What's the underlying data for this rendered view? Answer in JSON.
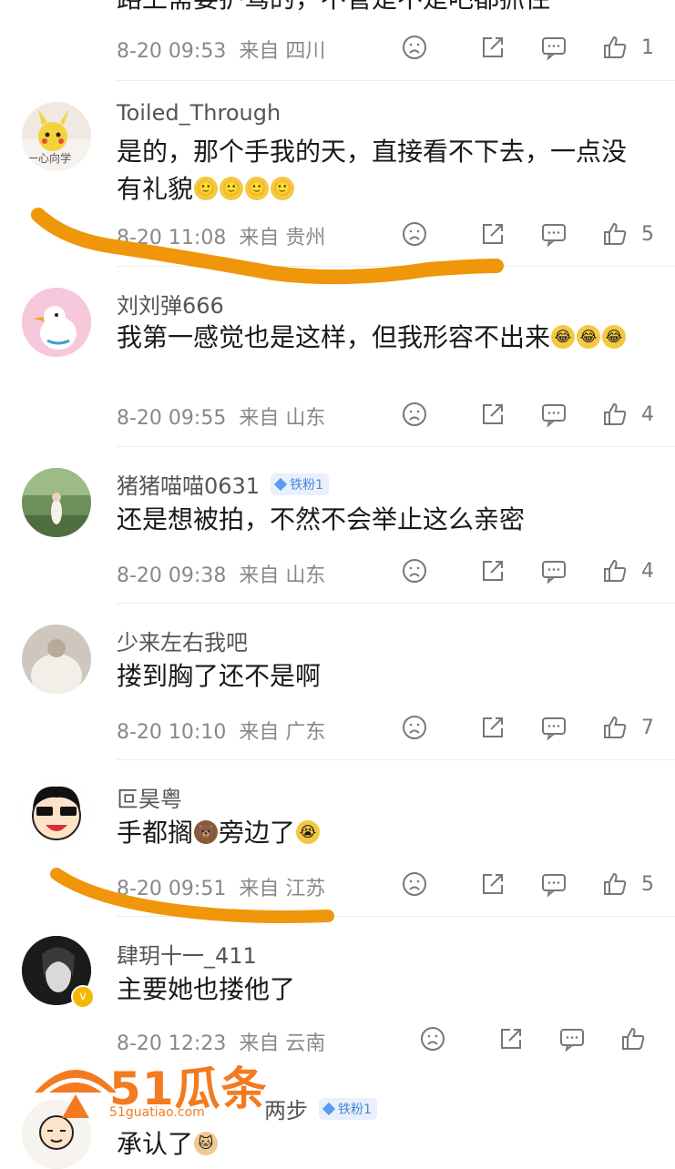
{
  "comments": [
    {
      "partial_text": "路上需要护驾的，不管是不是吧都抓住",
      "time": "8-20 09:53",
      "location": "来自 四川",
      "likes": "1"
    },
    {
      "user": "Toiled_Through",
      "text": "是的，那个手我的天，直接看不下去，一点没有礼貌",
      "emojis": "🙂🙂🙂🙂",
      "time": "8-20 11:08",
      "location": "来自 贵州",
      "likes": "5",
      "avatar_caption": "一心向学"
    },
    {
      "user": "刘刘弹666",
      "text": "我第一感觉也是这样，但我形容不出来",
      "emojis": "😂😂😂",
      "time": "8-20 09:55",
      "location": "来自 山东",
      "likes": "4"
    },
    {
      "user": "猪猪喵喵0631",
      "badge": "铁粉1",
      "text": "还是想被拍，不然不会举止这么亲密",
      "time": "8-20 09:38",
      "location": "来自 山东",
      "likes": "4"
    },
    {
      "user": "少来左右我吧",
      "text": "搂到胸了还不是啊",
      "time": "8-20 10:10",
      "location": "来自 广东",
      "likes": "7"
    },
    {
      "user": "叵昊粤",
      "text": "手都搁",
      "emoji_mid": "🐻",
      "text2": "旁边了",
      "emoji_end": "😭",
      "time": "8-20 09:51",
      "location": "来自 江苏",
      "likes": "5"
    },
    {
      "user": "肆玥十一_411",
      "text": "主要她也搂他了",
      "time": "8-20 12:23",
      "location": "来自 云南",
      "likes": ""
    },
    {
      "user_partial": "两步",
      "badge": "铁粉1",
      "text": "承认了",
      "emoji_end": "🐱"
    }
  ],
  "watermark": {
    "brand": "51瓜条",
    "url": "51guatiao.com"
  },
  "colors": {
    "highlight_stroke": "#f0960a",
    "badge_bg": "#e8f0fb",
    "badge_text": "#4a86d6"
  },
  "icons": [
    "dislike-face-icon",
    "share-icon",
    "comment-icon",
    "like-thumb-icon"
  ]
}
